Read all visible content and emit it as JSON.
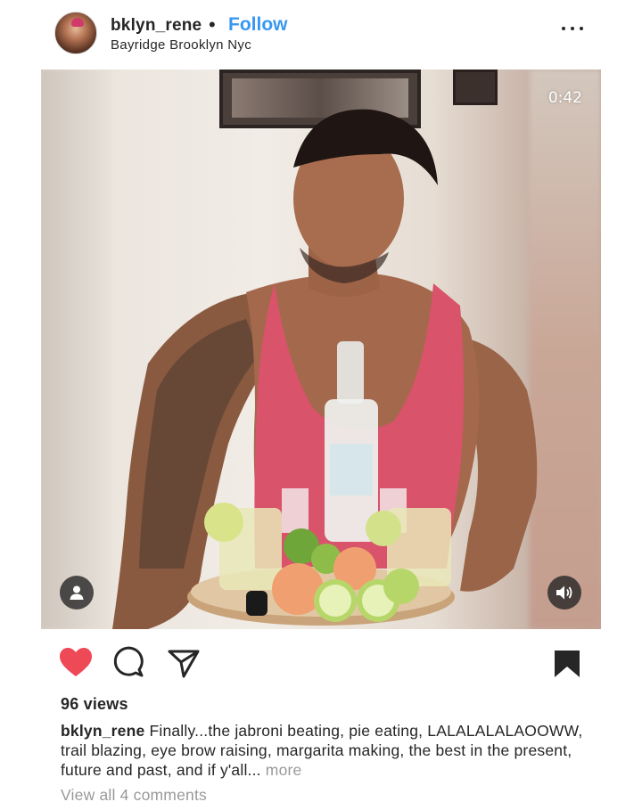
{
  "post": {
    "username": "bklyn_rene",
    "separator": "•",
    "follow_label": "Follow",
    "location": "Bayridge Brooklyn Nyc"
  },
  "video": {
    "duration": "0:42"
  },
  "actions": {
    "liked": true,
    "like_color": "#ed4956",
    "saved": true
  },
  "views": "96 views",
  "caption": {
    "username": "bklyn_rene",
    "text": "Finally...the jabroni beating, pie eating, LALALALALAOOWW, trail blazing, eye brow raising, margarita making, the best in the present, future and past, and if y'all...",
    "more_label": "more"
  },
  "comments_link": "View all 4 comments",
  "icons": {
    "more": "more-horizontal-icon",
    "user": "tagged-user-icon",
    "sound": "speaker-icon",
    "like": "heart-icon",
    "comment": "comment-bubble-icon",
    "share": "paper-plane-icon",
    "save": "bookmark-icon"
  }
}
